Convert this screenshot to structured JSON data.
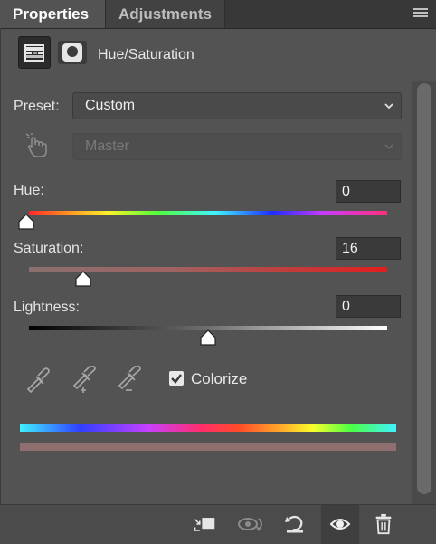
{
  "tabs": [
    {
      "label": "Properties",
      "active": true
    },
    {
      "label": "Adjustments",
      "active": false
    }
  ],
  "header": {
    "title": "Hue/Saturation"
  },
  "preset": {
    "label": "Preset:",
    "value": "Custom"
  },
  "channel": {
    "value": "Master",
    "enabled": false
  },
  "sliders": {
    "hue": {
      "label": "Hue:",
      "value": "0",
      "range": [
        0,
        360
      ]
    },
    "saturation": {
      "label": "Saturation:",
      "value": "16",
      "range": [
        0,
        100
      ]
    },
    "lightness": {
      "label": "Lightness:",
      "value": "0",
      "range": [
        -100,
        100
      ]
    }
  },
  "colorize": {
    "label": "Colorize",
    "checked": true
  },
  "icons": {
    "menu": "panel-menu-icon",
    "adjustment_layer": "hue-saturation-layer-icon",
    "mask": "layer-mask-icon",
    "target": "targeted-adjustment-hand-icon",
    "eyedroppers": [
      "eyedropper-icon",
      "eyedropper-add-icon",
      "eyedropper-subtract-icon"
    ],
    "footer": [
      "clip-to-layer-icon",
      "view-previous-state-icon",
      "reset-icon",
      "toggle-visibility-icon",
      "delete-icon"
    ]
  },
  "colors": {
    "panel_bg": "#535353",
    "tabbar_bg": "#383838",
    "text": "#e6e6e6"
  }
}
